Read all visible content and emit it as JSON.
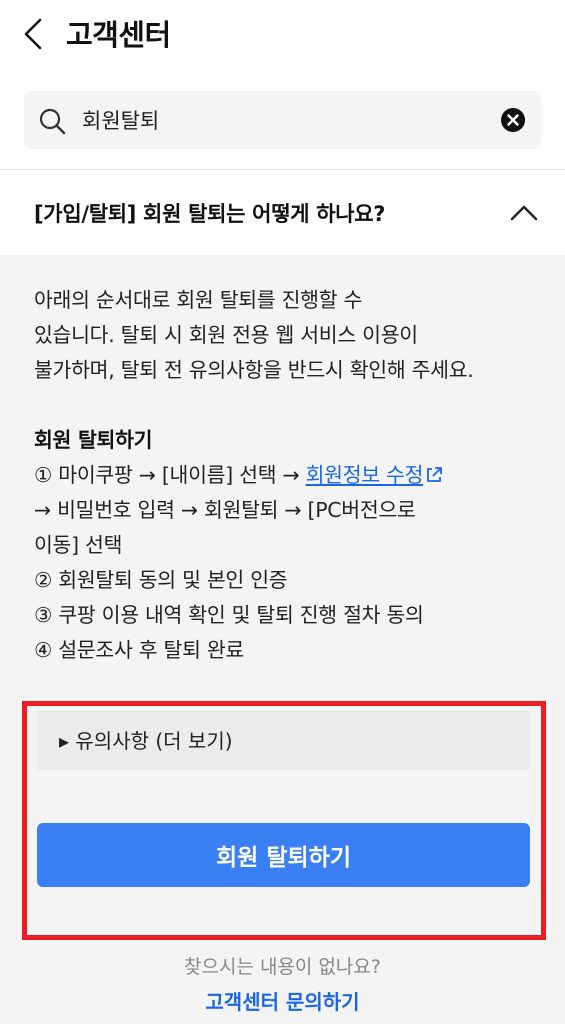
{
  "header": {
    "title": "고객센터",
    "back_icon": "chevron-left-icon"
  },
  "search": {
    "value": "회원탈퇴",
    "placeholder": "",
    "search_icon": "search-icon",
    "clear_icon": "clear-circle-icon"
  },
  "faq": {
    "question": "[가입/탈퇴] 회원 탈퇴는 어떻게 하나요?",
    "expanded": true,
    "toggle_icon": "chevron-up-icon",
    "intro_lines": [
      "아래의 순서대로 회원 탈퇴를 진행할 수",
      "있습니다. 탈퇴 시 회원 전용 웹 서비스 이용이",
      "불가하며, 탈퇴 전 유의사항을 반드시 확인해 주세요."
    ],
    "steps_title": "회원 탈퇴하기",
    "step1_prefix": "① 마이쿠팡 → [내이름] 선택 → ",
    "step1_link": "회원정보 수정",
    "step1_line2": "→ 비밀번호 입력 → 회원탈퇴 → [PC버전으로",
    "step1_line3": "이동] 선택",
    "step2": "② 회원탈퇴 동의 및 본인 인증",
    "step3": "③ 쿠팡 이용 내역 확인 및 탈퇴 진행 절차 동의",
    "step4": "④ 설문조사 후 탈퇴 완료",
    "notice_label": "▸ 유의사항 (더 보기)",
    "withdraw_button": "회원 탈퇴하기"
  },
  "footer": {
    "question": "찾으시는 내용이 없나요?",
    "link": "고객센터 문의하기"
  },
  "colors": {
    "accent": "#3b7ff5",
    "link": "#1a66e8",
    "highlight_frame": "#ec1c24",
    "panel_bg": "#f4f4f4"
  }
}
